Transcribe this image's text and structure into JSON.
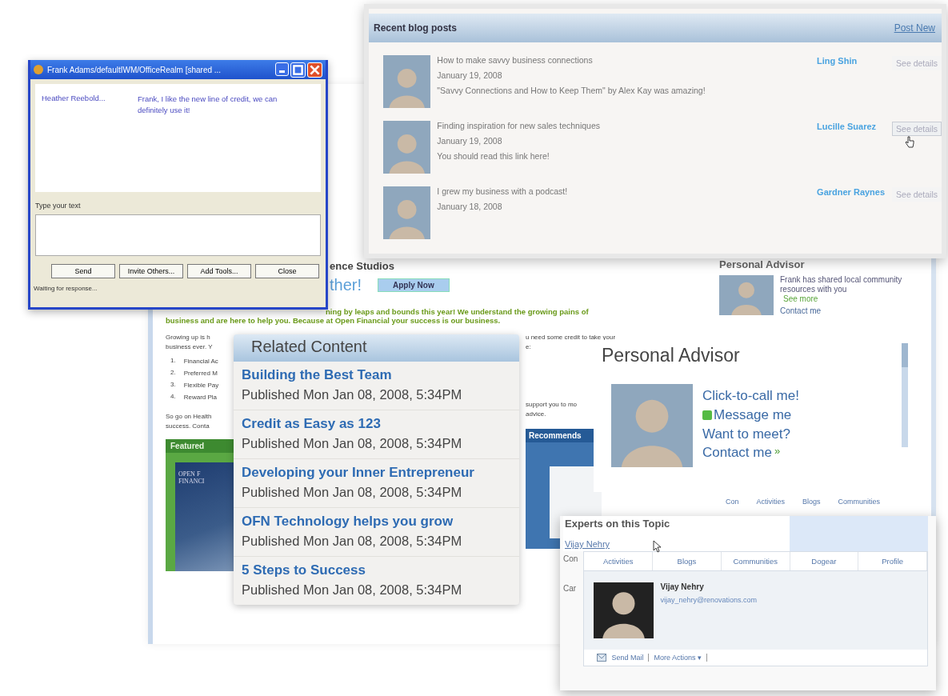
{
  "background_page": {
    "heading": "ence Studios",
    "tagline": "ther!",
    "apply_button": "Apply Now",
    "intro_lines": [
      "ning by leaps and bounds this year! We understand the growing pains of",
      "business and are here to help you. Because at Open Financial your success is our business."
    ],
    "body_left": [
      "Growing up is h",
      "business ever. Y"
    ],
    "list_items": [
      {
        "number": "1.",
        "text": "Financial Ac"
      },
      {
        "number": "2.",
        "text": "Preferred M"
      },
      {
        "number": "3.",
        "text": "Flexible Pay"
      },
      {
        "number": "4.",
        "text": "Reward Pla"
      }
    ],
    "body_left_2": [
      "So go on Health",
      "success. Conta"
    ],
    "body_right": [
      "u need some credit to take your",
      "e:"
    ],
    "body_right_2": [
      "support you to mo",
      "advice."
    ],
    "featured_label": "Featured",
    "featured_image_text": [
      "OPEN F",
      "FINANCI"
    ],
    "recommends_label": "Recommends",
    "advisor_title": "Personal Advisor",
    "advisor_note": "Frank has shared local community resources with you",
    "advisor_see_more": "See more",
    "advisor_contact": "Contact me",
    "profile_tabs": [
      {
        "label": "Con",
        "selected": false
      },
      {
        "label": "Activities",
        "selected": false
      },
      {
        "label": "Blogs",
        "selected": false
      },
      {
        "label": "Communities",
        "selected": false
      }
    ]
  },
  "chat_window": {
    "title": "Frank Adams/defaultIWM/OfficeRealm [shared ...",
    "messages": [
      {
        "sender": "Heather Reebold...",
        "text": "Frank, I like the new line of credit, we can definitely use it!"
      }
    ],
    "input_label": "Type your text",
    "buttons": [
      "Send",
      "Invite Others...",
      "Add Tools...",
      "Close"
    ],
    "status": "Waiting for response..."
  },
  "blog_panel": {
    "title": "Recent blog posts",
    "action": "Post New",
    "posts": [
      {
        "title": "How to make savvy business connections",
        "date": "January 19, 2008",
        "excerpt": "\"Savvy Connections and How to Keep Them\" by Alex Kay was amazing!",
        "author": "Ling Shin",
        "details": "See details",
        "hovered": false
      },
      {
        "title": "Finding inspiration for new sales techniques",
        "date": "January 19, 2008",
        "excerpt": "You should read this link here!",
        "author": "Lucille Suarez",
        "details": "See details",
        "hovered": true
      },
      {
        "title": "I grew my business with a podcast!",
        "date": "January 18, 2008",
        "author": "Gardner Raynes",
        "details": "See details",
        "hovered": false
      }
    ]
  },
  "related_content": {
    "title": "Related Content",
    "items": [
      {
        "title": "Building the Best Team",
        "published": "Published Mon Jan 08, 2008, 5:34PM"
      },
      {
        "title": "Credit as Easy as 123",
        "published": "Published Mon Jan 08, 2008, 5:34PM"
      },
      {
        "title": "Developing your Inner Entrepreneur",
        "published": "Published Mon Jan 08, 2008, 5:34PM"
      },
      {
        "title": "OFN Technology helps you grow",
        "published": "Published Mon Jan 08, 2008, 5:34PM"
      },
      {
        "title": "5 Steps to Success",
        "published": "Published Mon Jan 08, 2008, 5:34PM"
      }
    ]
  },
  "personal_advisor": {
    "title": "Personal Advisor",
    "links": [
      {
        "kind": "plain",
        "text": "Click-to-call me!"
      },
      {
        "kind": "status",
        "text": "Message me",
        "color": "#55bb44"
      },
      {
        "kind": "plain",
        "text": "Want to meet?"
      }
    ],
    "contact": "Contact me",
    "contact_mark": "»"
  },
  "experts_panel": {
    "title": "Experts on this Topic",
    "expert_link": "Vijay Nehry",
    "side_labels": [
      "Con",
      "Car"
    ],
    "tabs": [
      {
        "label": "Activities",
        "selected": false
      },
      {
        "label": "Blogs",
        "selected": false
      },
      {
        "label": "Communities",
        "selected": false
      },
      {
        "label": "Dogear",
        "selected": false
      },
      {
        "label": "Profile",
        "selected": false
      }
    ],
    "name": "Vijay Nehry",
    "email": "vijay_nehry@renovations.com",
    "actions": [
      "Send Mail",
      "More Actions ▾"
    ]
  }
}
